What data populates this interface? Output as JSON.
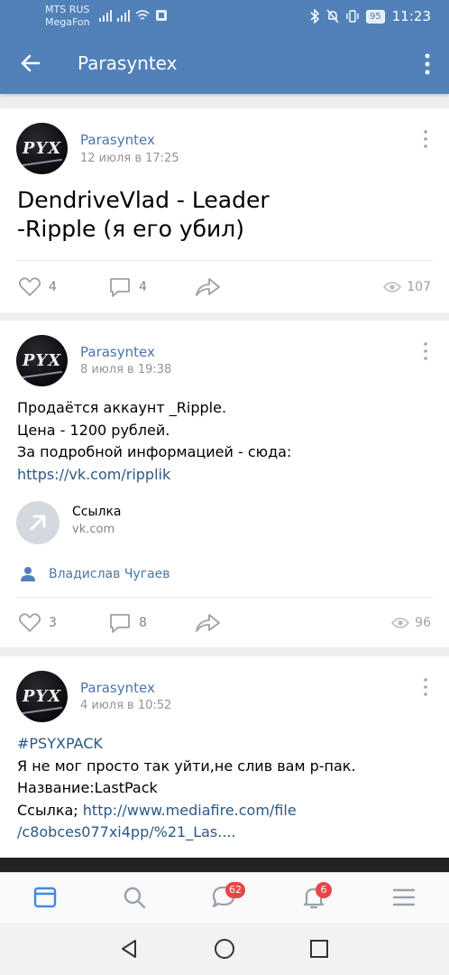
{
  "status_bar": {
    "carrier1": "MTS RUS",
    "carrier2": "MegaFon",
    "battery": "95",
    "time": "11:23"
  },
  "header": {
    "title": "Parasyntex",
    "accent": "#5181b8"
  },
  "posts": [
    {
      "avatar_text": "PYX",
      "author": "Parasyntex",
      "date": "12 июля в 17:25",
      "text_line1": "DendriveVlad - Leader",
      "text_line2": "-Ripple (я его убил)",
      "likes": "4",
      "comments": "4",
      "views": "107"
    },
    {
      "avatar_text": "PYX",
      "author": "Parasyntex",
      "date": "8 июля в 19:38",
      "text_line1": "Продаётся аккаунт _Ripple.",
      "text_line2": "Цена - 1200 рублей.",
      "text_line3": "За подробной информацией - сюда:",
      "link": "https://vk.com/ripplik",
      "preview_title": "Ссылка",
      "preview_domain": "vk.com",
      "signer": "Владислав Чугаев",
      "likes": "3",
      "comments": "8",
      "views": "96"
    },
    {
      "avatar_text": "PYX",
      "author": "Parasyntex",
      "date": "4 июля в 10:52",
      "hashtag": "#PSYXPACK",
      "text_line1": "Я не мог просто так уйти,не слив вам p-пак.",
      "text_line2": "Название:LastPack",
      "text_line3_prefix": "Ссылка; ",
      "link_part1": "http://www.mediafire.com/file",
      "link_part2": "/c8obces077xi4pp/%21_Las...."
    }
  ],
  "tabbar": {
    "messages_badge": "62",
    "notifications_badge": "6"
  }
}
